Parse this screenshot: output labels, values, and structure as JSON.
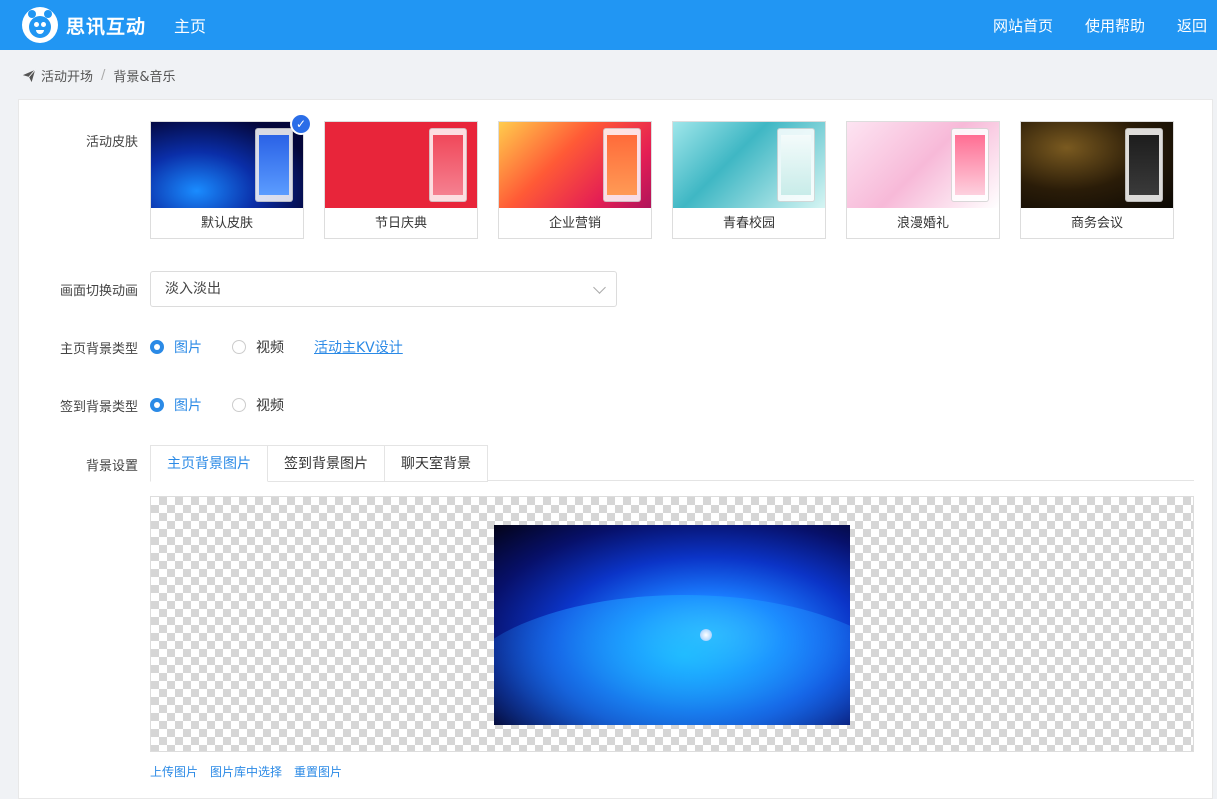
{
  "header": {
    "brand": "思讯互动",
    "nav_home": "主页",
    "links": [
      "网站首页",
      "使用帮助",
      "返回"
    ]
  },
  "breadcrumb": {
    "root": "活动开场",
    "separator": "/",
    "current": "背景&音乐"
  },
  "form": {
    "skin_label": "活动皮肤",
    "skins": [
      {
        "name": "默认皮肤",
        "selected": true
      },
      {
        "name": "节日庆典",
        "selected": false
      },
      {
        "name": "企业营销",
        "selected": false
      },
      {
        "name": "青春校园",
        "selected": false
      },
      {
        "name": "浪漫婚礼",
        "selected": false
      },
      {
        "name": "商务会议",
        "selected": false
      }
    ],
    "transition_label": "画面切换动画",
    "transition_value": "淡入淡出",
    "home_bg_type_label": "主页背景类型",
    "home_bg_options": [
      "图片",
      "视频"
    ],
    "home_bg_selected": "图片",
    "kv_design_link": "活动主KV设计",
    "signin_bg_type_label": "签到背景类型",
    "signin_bg_options": [
      "图片",
      "视频"
    ],
    "signin_bg_selected": "图片",
    "bg_settings_label": "背景设置",
    "bg_tabs": [
      "主页背景图片",
      "签到背景图片",
      "聊天室背景"
    ],
    "bg_tab_active": "主页背景图片",
    "actions": [
      "上传图片",
      "图片库中选择",
      "重置图片"
    ]
  },
  "colors": {
    "header_bg": "#2196f3",
    "accent": "#2b8ae6",
    "check_badge": "#2b6ee8"
  }
}
